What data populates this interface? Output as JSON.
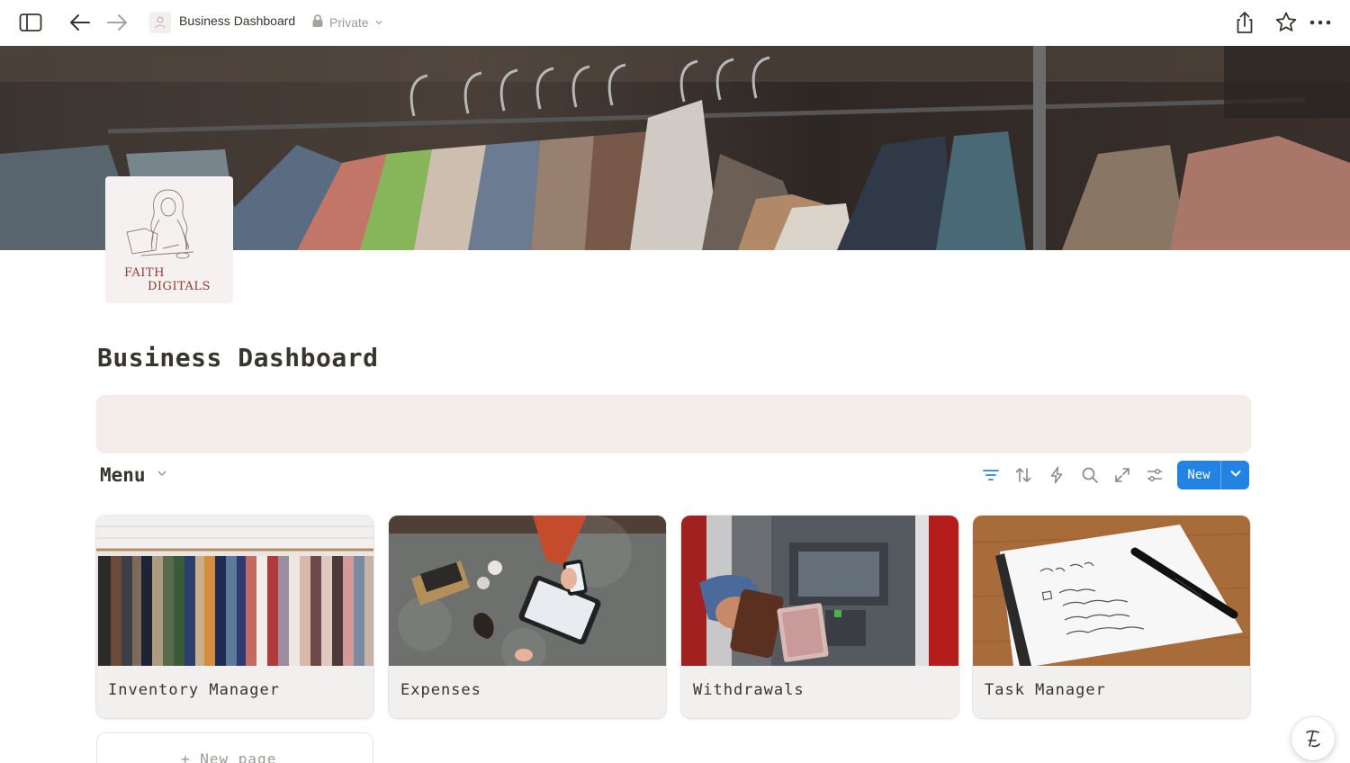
{
  "topbar": {
    "page_title": "Business Dashboard",
    "privacy_label": "Private"
  },
  "logo": {
    "line1": "FAITH",
    "line2": "DIGITALS"
  },
  "page": {
    "title": "Business Dashboard"
  },
  "database": {
    "title": "Menu",
    "new_button_label": "New",
    "cards": [
      {
        "title": "Inventory Manager"
      },
      {
        "title": "Expenses"
      },
      {
        "title": "Withdrawals"
      },
      {
        "title": "Task Manager"
      }
    ],
    "new_page_label": "+ New page"
  },
  "icons": {
    "sidebar_toggle": "sidebar-toggle-icon",
    "back": "arrow-left-icon",
    "forward": "arrow-right-icon",
    "lock": "lock-icon",
    "share": "share-icon",
    "favorite": "star-icon",
    "more": "more-horizontal-icon",
    "filter": "filter-icon",
    "sort": "sort-icon",
    "automation": "lightning-icon",
    "search": "search-icon",
    "expand": "expand-icon",
    "settings": "settings-sliders-icon",
    "help": "notion-ai-icon"
  },
  "colors": {
    "accent": "#2383e2",
    "callout_bg": "#f4ece9",
    "logo_text": "#8e3a33",
    "card_bg": "#f1f0ef"
  }
}
